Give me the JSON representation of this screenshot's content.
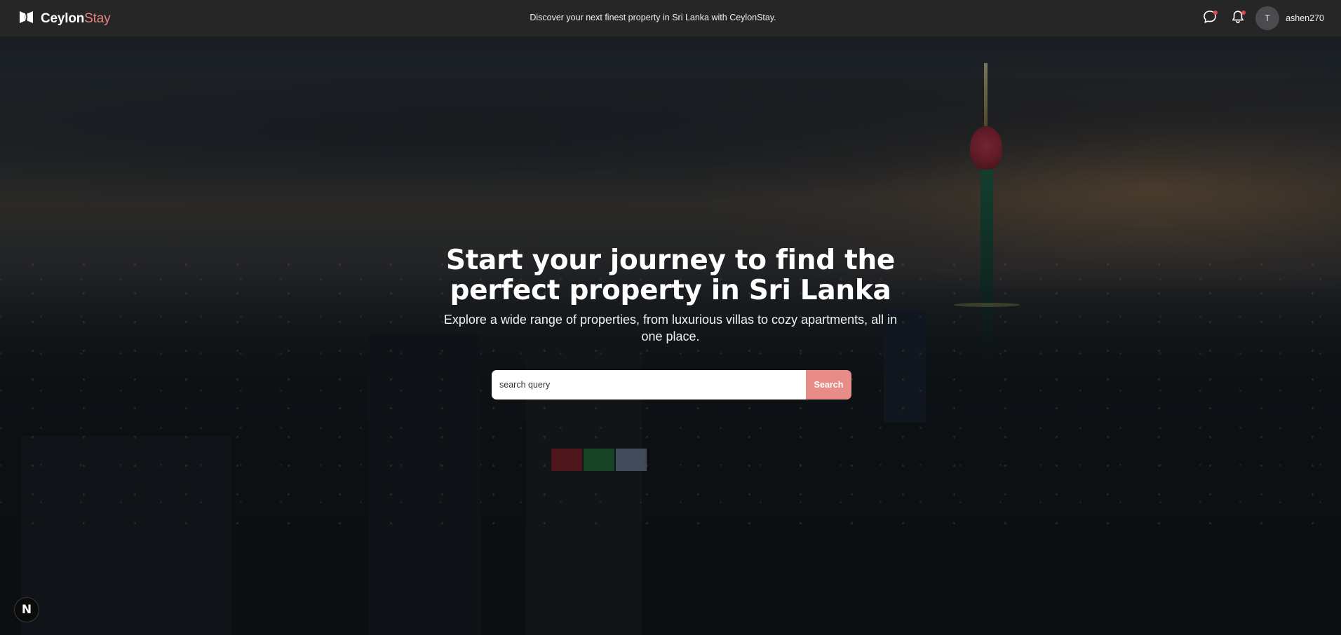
{
  "header": {
    "brand_primary": "Ceylon",
    "brand_accent": "Stay",
    "tagline": "Discover your next finest property in Sri Lanka with CeylonStay.",
    "user": {
      "avatar_initial": "T",
      "username": "ashen270"
    },
    "icons": [
      "logo-icon",
      "chat-icon",
      "bell-icon"
    ],
    "accent_color": "#e8837f",
    "notification_dot_color": "#e5484d"
  },
  "hero": {
    "title": "Start your journey to find the perfect property in Sri Lanka",
    "subtitle": "Explore a wide range of properties, from luxurious villas to cozy apartments, all in one place.",
    "search": {
      "placeholder": "search query",
      "value": "",
      "button_label": "Search",
      "button_color": "#e98b86"
    }
  },
  "dev_badge": {
    "label": "N"
  }
}
